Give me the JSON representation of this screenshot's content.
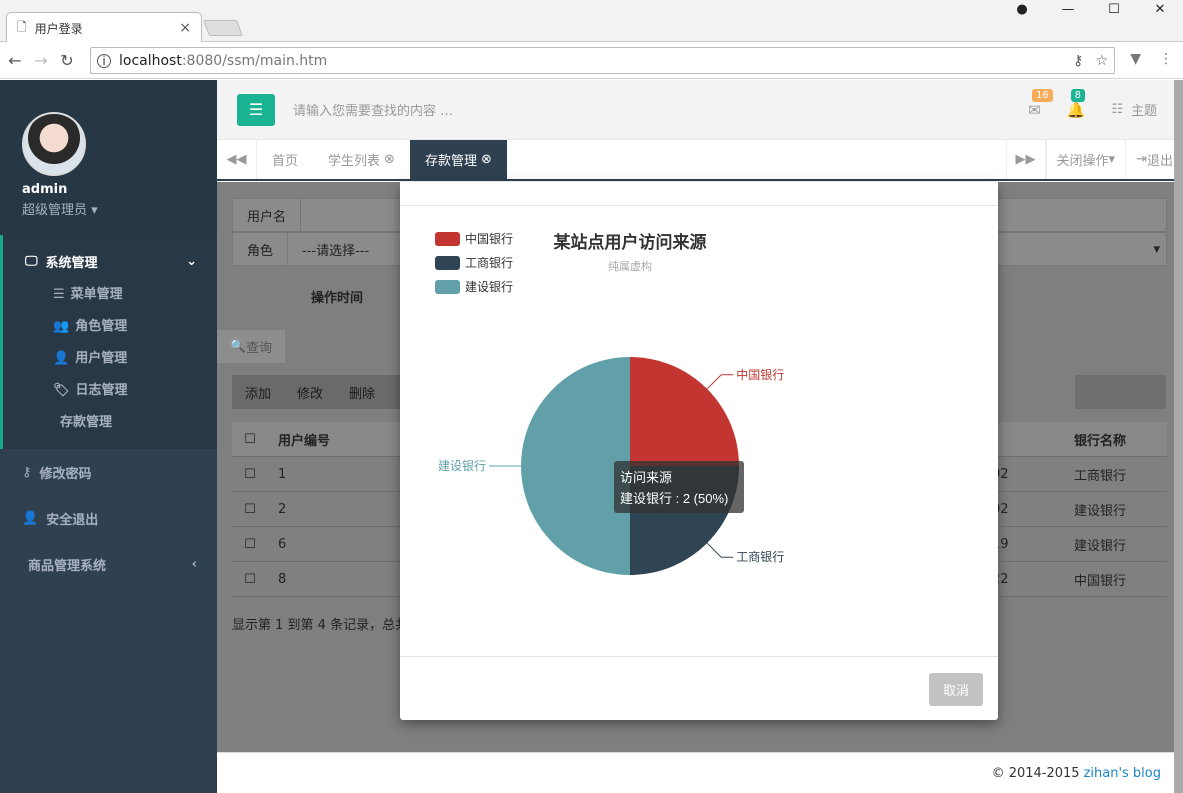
{
  "browser": {
    "tab_title": "用户登录",
    "tab_close": "×",
    "url_host": "localhost",
    "url_path": ":8080/ssm/main.htm",
    "window_controls": [
      "—",
      "☐",
      "✕"
    ]
  },
  "sidebar": {
    "user_name": "admin",
    "user_role": "超级管理员",
    "group_label": "系统管理",
    "sub_items": [
      {
        "label": "菜单管理",
        "icon": "sliders-icon"
      },
      {
        "label": "角色管理",
        "icon": "users-icon"
      },
      {
        "label": "用户管理",
        "icon": "user-icon"
      },
      {
        "label": "日志管理",
        "icon": "tags-icon"
      },
      {
        "label": "存款管理",
        "icon": ""
      }
    ],
    "items": [
      {
        "label": "修改密码",
        "icon": "key-icon"
      },
      {
        "label": "安全退出",
        "icon": "user-times-icon"
      },
      {
        "label": "商品管理系统",
        "icon": ""
      }
    ]
  },
  "topbar": {
    "search_placeholder": "请输入您需要查找的内容 …",
    "mail_count": "16",
    "bell_count": "8",
    "theme_label": "主题",
    "mail_badge_color": "#f8ac59",
    "bell_badge_color": "#1ab394"
  },
  "tabs": {
    "items": [
      {
        "label": "首页",
        "closable": false
      },
      {
        "label": "学生列表",
        "closable": true
      },
      {
        "label": "存款管理",
        "closable": true,
        "active": true
      }
    ],
    "close_ops": "关闭操作",
    "logout": "退出"
  },
  "form": {
    "username_label": "用户名",
    "role_label": "角色",
    "role_select": "---请选择---",
    "optime_label": "操作时间",
    "query_button": "查询"
  },
  "toolbar": {
    "add": "添加",
    "edit": "修改",
    "delete": "删除"
  },
  "table": {
    "headers": {
      "id": "用户编号",
      "bank": "银行名称"
    },
    "rows": [
      {
        "id": "1",
        "mid": "02",
        "bank": "工商银行"
      },
      {
        "id": "2",
        "mid": "02",
        "bank": "建设银行"
      },
      {
        "id": "6",
        "mid": "19",
        "bank": "建设银行"
      },
      {
        "id": "8",
        "mid": "22",
        "bank": "中国银行"
      }
    ],
    "pager": "显示第 1 到第 4 条记录，总共"
  },
  "footer": {
    "copy": "© 2014-2015",
    "blog": "zihan's blog"
  },
  "modal": {
    "cancel_label": "取消"
  },
  "chart_data": {
    "type": "pie",
    "title": "某站点用户访问来源",
    "subtitle": "纯属虚构",
    "legend_position": "top-left",
    "series": [
      {
        "name": "中国银行",
        "value": 1,
        "color": "#c23531"
      },
      {
        "name": "工商银行",
        "value": 1,
        "color": "#2f4554"
      },
      {
        "name": "建设银行",
        "value": 2,
        "color": "#61a0a8"
      }
    ],
    "tooltip": {
      "title": "访问来源",
      "text": "建设银行 : 2 (50%)"
    }
  }
}
